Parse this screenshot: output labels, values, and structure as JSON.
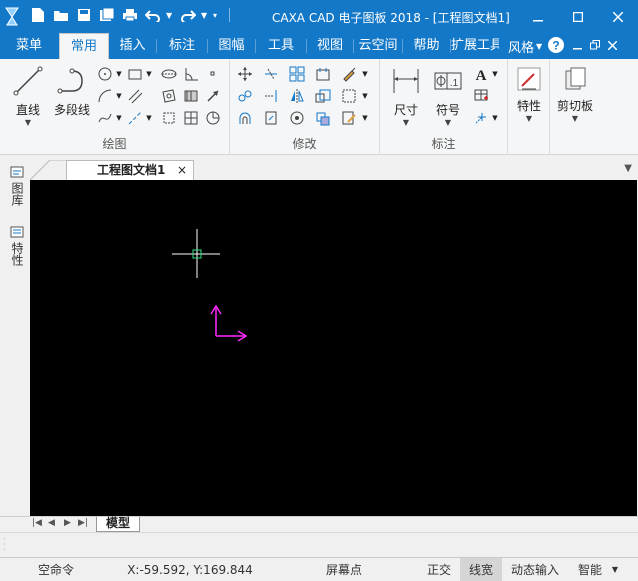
{
  "app": {
    "title": "CAXA CAD 电子图板 2018 - [工程图文档1]",
    "brand_color": "#1478c8"
  },
  "tabs": {
    "menu": "菜单",
    "common": "常用",
    "insert": "插入",
    "annotate": "标注",
    "sheet": "图幅",
    "tools": "工具",
    "view": "视图",
    "cloud": "云空间",
    "help": "帮助",
    "extend": "扩展工具",
    "style": "风格"
  },
  "ribbon": {
    "draw": {
      "label": "绘图",
      "line": "直线",
      "polyline": "多段线"
    },
    "modify": {
      "label": "修改"
    },
    "annotation": {
      "label": "标注",
      "dimension": "尺寸",
      "symbol": "符号"
    },
    "properties": "特性",
    "clipboard": "剪切板"
  },
  "sidebar": {
    "library": "图库",
    "properties": "特性"
  },
  "document": {
    "tab": "工程图文档1",
    "close": "×"
  },
  "layout": {
    "model": "模型"
  },
  "status": {
    "command": "空命令",
    "coords": "X:-59.592, Y:169.844",
    "snap": "屏幕点",
    "ortho": "正交",
    "lineweight": "线宽",
    "dynamic_input": "动态输入",
    "smart": "智能"
  }
}
